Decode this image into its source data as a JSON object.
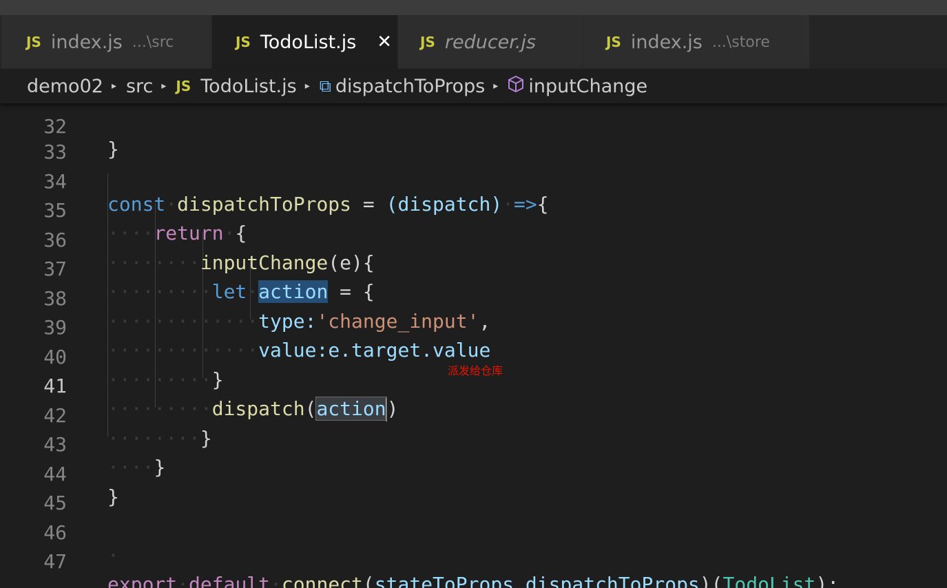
{
  "tabs": [
    {
      "icon": "JS",
      "name": "index.js",
      "hint": "...\\src"
    },
    {
      "icon": "JS",
      "name": "TodoList.js",
      "close": "✕"
    },
    {
      "icon": "JS",
      "name": "reducer.js"
    },
    {
      "icon": "JS",
      "name": "index.js",
      "hint": "...\\store"
    }
  ],
  "breadcrumb": {
    "folder": "demo02",
    "subfolder": "src",
    "file_icon": "JS",
    "file": "TodoList.js",
    "symbol1": "dispatchToProps",
    "symbol2": "inputChange"
  },
  "editor": {
    "lines": [
      {
        "n": "32"
      },
      {
        "n": "33"
      },
      {
        "n": "34"
      },
      {
        "n": "35"
      },
      {
        "n": "36"
      },
      {
        "n": "37"
      },
      {
        "n": "38"
      },
      {
        "n": "39"
      },
      {
        "n": "40"
      },
      {
        "n": "41"
      },
      {
        "n": "42"
      },
      {
        "n": "43"
      },
      {
        "n": "44"
      },
      {
        "n": "45"
      },
      {
        "n": "46"
      },
      {
        "n": "47"
      }
    ],
    "tokens": {
      "brace_close": "}",
      "const": "const",
      "dispatchToProps": "dispatchToProps",
      "assign": " = ",
      "dispatch_param": "(dispatch)",
      "arrow": "=>",
      "brace_open": "{",
      "return": "return",
      "inputChange": "inputChange",
      "params_e": "(e){",
      "let": "let",
      "action": "action",
      "eq_brace": " = {",
      "type_key": "type:",
      "type_val": "'change_input'",
      "comma": ",",
      "value_key": "value:",
      "e_target": "e.target.value",
      "dispatch_fn": "dispatch",
      "paren_open": "(",
      "paren_close": ")",
      "export": "export",
      "default": "default",
      "connect": "connect",
      "connect_args_open": "(",
      "stateToProps": "stateToProps",
      "comma2": ",",
      "dispatchToProps_arg": "dispatchToProps",
      "args_close": ")(",
      "TodoList": "TodoList",
      "end": ");"
    },
    "annotation": "派发给仓库"
  },
  "colors": {
    "background": "#1e1e1e",
    "keyword": "#569cd6",
    "control": "#c586c0",
    "function": "#dcdcaa",
    "variable": "#9cdcfe",
    "string": "#ce9178",
    "class": "#4ec9b0",
    "annotation": "#e51400"
  }
}
